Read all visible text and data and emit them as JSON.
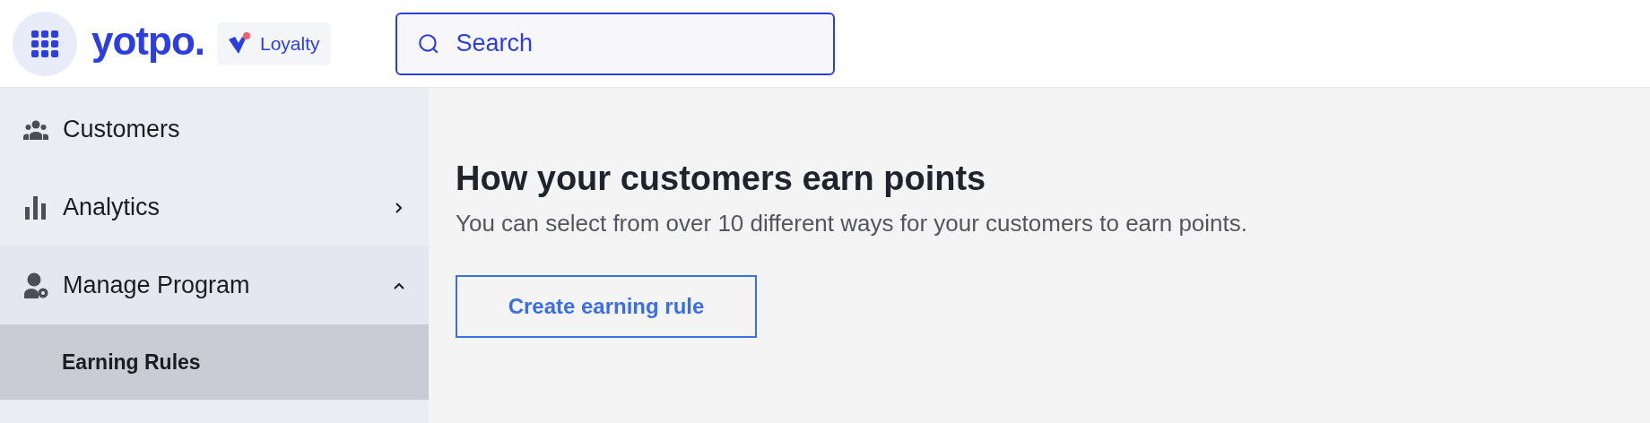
{
  "header": {
    "logo": "yotpo.",
    "product": "Loyalty",
    "search": {
      "placeholder": "Search"
    }
  },
  "sidebar": {
    "items": [
      {
        "label": "Customers"
      },
      {
        "label": "Analytics",
        "expanded": false
      },
      {
        "label": "Manage Program",
        "expanded": true,
        "children": [
          {
            "label": "Earning Rules",
            "selected": true
          }
        ]
      }
    ]
  },
  "main": {
    "title": "How your customers earn points",
    "subtitle": "You can select from over 10 different ways for your customers to earn points.",
    "button": "Create earning rule"
  }
}
